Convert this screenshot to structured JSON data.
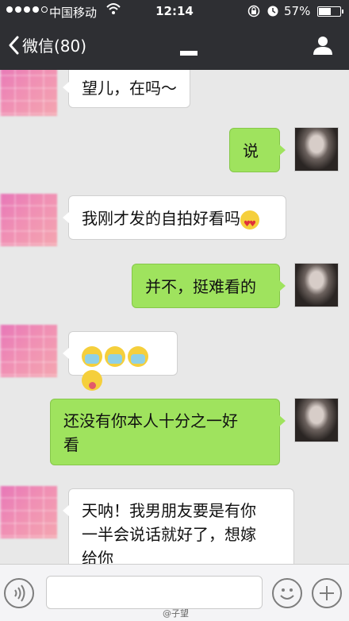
{
  "status_bar": {
    "carrier": "中国移动",
    "time": "12:14",
    "battery_percent": "57%",
    "battery_level": 0.57
  },
  "nav": {
    "back_label": "微信(80)"
  },
  "messages": [
    {
      "side": "in",
      "text": "望儿，在吗～"
    },
    {
      "side": "out",
      "text": "说"
    },
    {
      "side": "in",
      "text": "我刚才发的自拍好看吗",
      "emoji": [
        "heart-eyes-emoji"
      ]
    },
    {
      "side": "out",
      "text": "并不，挺难看的"
    },
    {
      "side": "in",
      "text": "",
      "emoji": [
        "crying-emoji",
        "crying-emoji",
        "crying-emoji",
        "tongue-emoji"
      ]
    },
    {
      "side": "out",
      "text_lines": [
        "还没有你本人十分之一好",
        "看"
      ]
    },
    {
      "side": "in",
      "text_lines": [
        "天呐！我男朋友要是有你",
        "一半会说话就好了，想嫁",
        "给你"
      ]
    }
  ],
  "input_bar": {
    "watermark": "@子望"
  },
  "icons": {
    "back": "chevron-left-icon",
    "contact": "person-icon",
    "voice": "voice-icon",
    "emoji": "smiley-icon",
    "more": "plus-icon"
  }
}
